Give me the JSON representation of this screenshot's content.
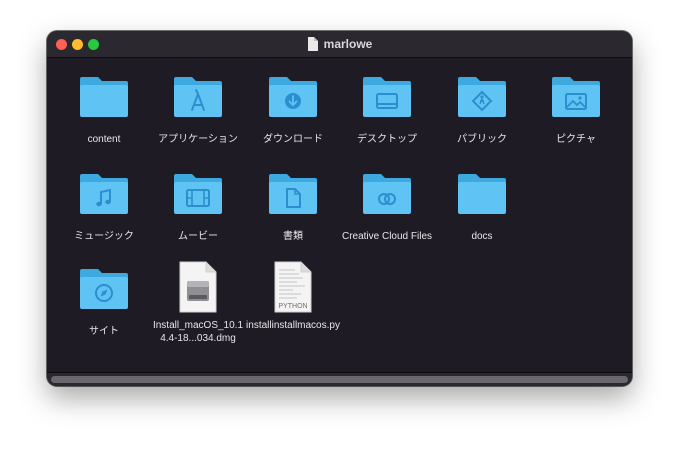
{
  "window": {
    "title": "marlowe",
    "title_icon": "document-icon"
  },
  "items": [
    {
      "label": "content",
      "kind": "folder",
      "glyph": "none"
    },
    {
      "label": "アプリケーション",
      "kind": "folder",
      "glyph": "appstore"
    },
    {
      "label": "ダウンロード",
      "kind": "folder",
      "glyph": "download"
    },
    {
      "label": "デスクトップ",
      "kind": "folder",
      "glyph": "desktop"
    },
    {
      "label": "パブリック",
      "kind": "folder",
      "glyph": "public"
    },
    {
      "label": "ピクチャ",
      "kind": "folder",
      "glyph": "pictures"
    },
    {
      "label": "ミュージック",
      "kind": "folder",
      "glyph": "music"
    },
    {
      "label": "ムービー",
      "kind": "folder",
      "glyph": "movies"
    },
    {
      "label": "書類",
      "kind": "folder",
      "glyph": "documents"
    },
    {
      "label": "Creative Cloud Files",
      "kind": "folder",
      "glyph": "creative-cloud"
    },
    {
      "label": "docs",
      "kind": "folder",
      "glyph": "none"
    },
    {
      "label": "サイト",
      "kind": "folder",
      "glyph": "sites"
    },
    {
      "label": "Install_macOS_10.14.4-18...034.dmg",
      "kind": "file",
      "glyph": "dmg"
    },
    {
      "label": "installinstallmacos.py",
      "kind": "file",
      "glyph": "python",
      "badge": "PYTHON"
    }
  ],
  "colors": {
    "folder_body": "#5fc4f3",
    "folder_tab": "#3ea9df",
    "folder_glyph": "#2b8fcf",
    "background": "#1f1b24"
  }
}
